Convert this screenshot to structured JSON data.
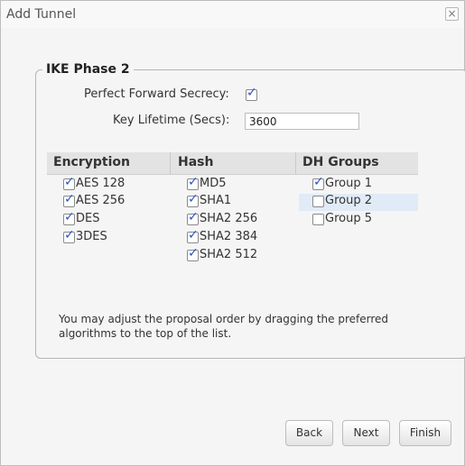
{
  "dialog": {
    "title": "Add Tunnel"
  },
  "section": {
    "legend": "IKE Phase 2"
  },
  "pfs": {
    "label": "Perfect Forward Secrecy:",
    "checked": true
  },
  "key_lifetime": {
    "label": "Key Lifetime (Secs):",
    "value": "3600"
  },
  "table": {
    "headers": [
      "Encryption",
      "Hash",
      "DH Groups"
    ],
    "encryption": [
      {
        "label": "AES 128",
        "checked": true
      },
      {
        "label": "AES 256",
        "checked": true
      },
      {
        "label": "DES",
        "checked": true
      },
      {
        "label": "3DES",
        "checked": true
      }
    ],
    "hash": [
      {
        "label": "MD5",
        "checked": true
      },
      {
        "label": "SHA1",
        "checked": true
      },
      {
        "label": "SHA2 256",
        "checked": true
      },
      {
        "label": "SHA2 384",
        "checked": true
      },
      {
        "label": "SHA2 512",
        "checked": true
      }
    ],
    "dh_groups": [
      {
        "label": "Group 1",
        "checked": true
      },
      {
        "label": "Group 2",
        "checked": false
      },
      {
        "label": "Group 5",
        "checked": false
      }
    ]
  },
  "note": "You may adjust the proposal order by dragging the preferred algorithms to the top of the list.",
  "buttons": {
    "back": "Back",
    "next": "Next",
    "finish": "Finish"
  },
  "colors": {
    "checkmark": "#2a54c7",
    "highlight": "#e1ebf8"
  }
}
